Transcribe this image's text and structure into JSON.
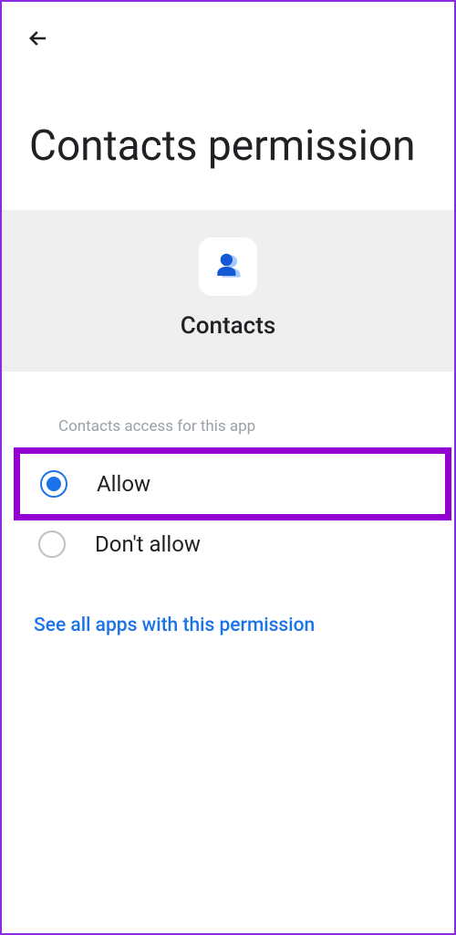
{
  "header": {
    "title": "Contacts permission"
  },
  "banner": {
    "icon": "contacts-icon",
    "label": "Contacts"
  },
  "section": {
    "label": "Contacts access for this app",
    "options": [
      {
        "label": "Allow",
        "selected": true,
        "highlighted": true
      },
      {
        "label": "Don't allow",
        "selected": false,
        "highlighted": false
      }
    ]
  },
  "link": {
    "see_all": "See all apps with this permission"
  }
}
